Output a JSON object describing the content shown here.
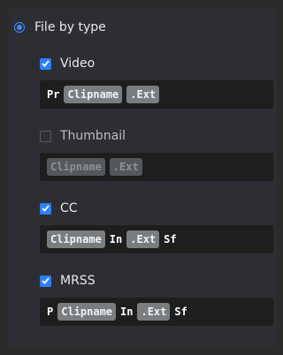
{
  "file_by_type": {
    "label": "File by type",
    "selected": true
  },
  "sections": [
    {
      "label": "Video",
      "checked": true,
      "pattern": [
        {
          "kind": "text",
          "value": "Pr"
        },
        {
          "kind": "token",
          "value": "Clipname"
        },
        {
          "kind": "token",
          "value": ".Ext"
        }
      ]
    },
    {
      "label": "Thumbnail",
      "checked": false,
      "pattern": [
        {
          "kind": "token",
          "value": "Clipname"
        },
        {
          "kind": "token",
          "value": ".Ext"
        }
      ]
    },
    {
      "label": "CC",
      "checked": true,
      "pattern": [
        {
          "kind": "token",
          "value": "Clipname"
        },
        {
          "kind": "text",
          "value": "In"
        },
        {
          "kind": "token",
          "value": ".Ext"
        },
        {
          "kind": "text",
          "value": "Sf"
        }
      ]
    },
    {
      "label": "MRSS",
      "checked": true,
      "pattern": [
        {
          "kind": "text",
          "value": "P"
        },
        {
          "kind": "token",
          "value": "Clipname"
        },
        {
          "kind": "text",
          "value": "In"
        },
        {
          "kind": "token",
          "value": ".Ext"
        },
        {
          "kind": "text",
          "value": "Sf"
        }
      ]
    }
  ]
}
